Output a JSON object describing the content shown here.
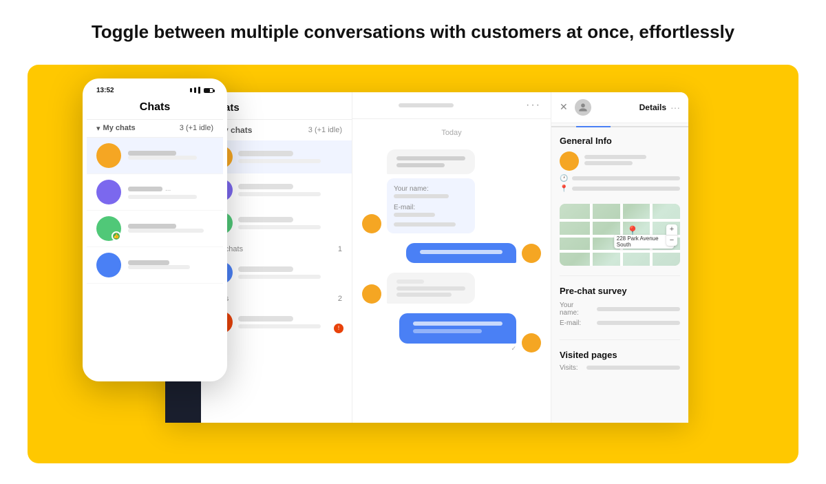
{
  "headline": "Toggle between multiple conversations with customers at once, effortlessly",
  "desktop": {
    "sidebar": {
      "icons": [
        "chat-bubble",
        "message",
        "grid",
        "inbox"
      ]
    },
    "chat_list": {
      "title": "Chats",
      "my_chats_label": "My chats",
      "my_chats_count": "3 (+1 idle)",
      "sections": [
        {
          "label": "sed chats",
          "count": "1"
        },
        {
          "label": "chats",
          "count": "2"
        }
      ]
    },
    "chat_main": {
      "date_label": "Today"
    },
    "details": {
      "title": "Details",
      "general_info_title": "General Info",
      "pre_chat_title": "Pre-chat survey",
      "your_name_label": "Your name:",
      "email_label": "E-mail:",
      "visited_pages_title": "Visited pages",
      "visits_label": "Visits:",
      "map_address": "228 Park Avenue South"
    }
  },
  "mobile": {
    "time": "13:52",
    "title": "Chats",
    "my_chats_label": "My chats",
    "my_chats_count": "3 (+1 idle)",
    "chat_items": [
      {
        "avatar_color": "av1",
        "has_badge": false
      },
      {
        "avatar_color": "av2",
        "has_badge": false,
        "dots": "..."
      },
      {
        "avatar_color": "av3",
        "has_badge": true,
        "badge": "👍"
      },
      {
        "avatar_color": "av4",
        "has_badge": false
      }
    ]
  }
}
